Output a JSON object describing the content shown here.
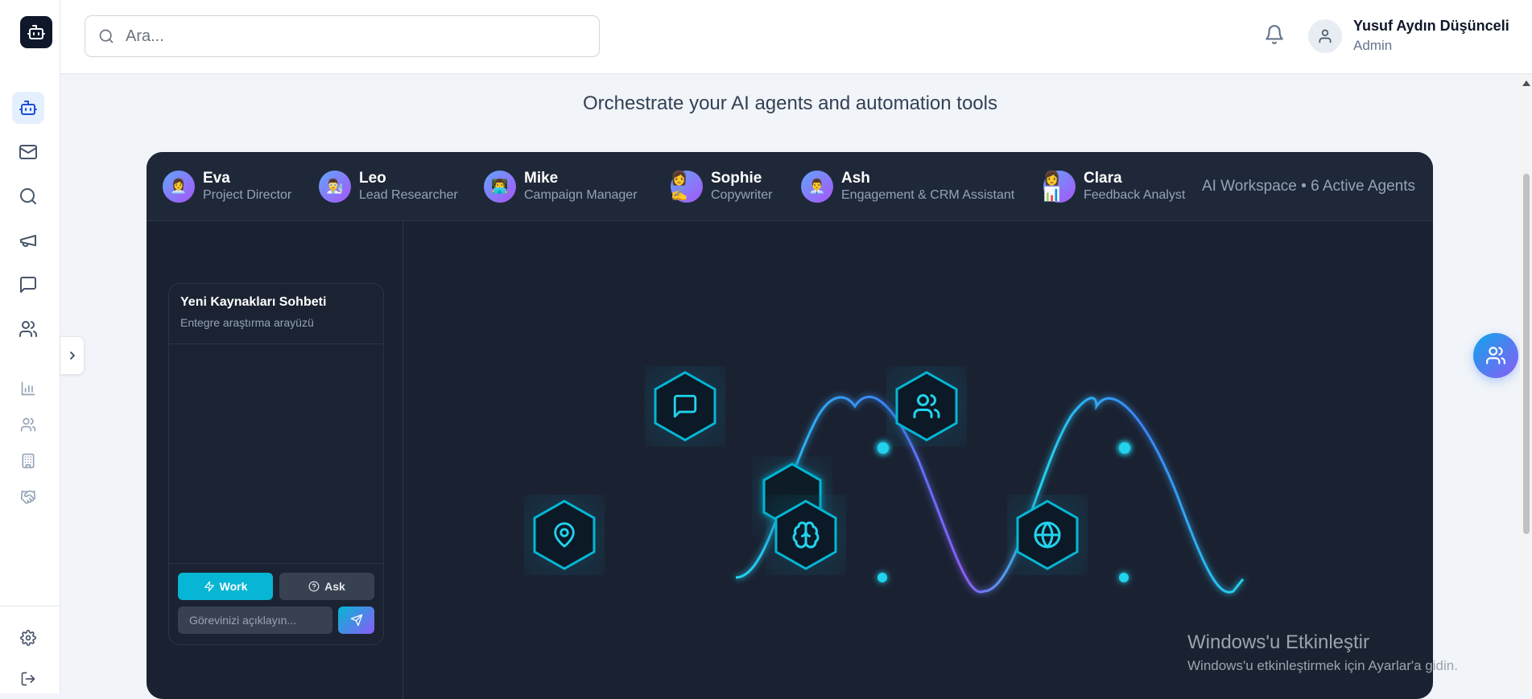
{
  "search": {
    "placeholder": "Ara..."
  },
  "user": {
    "name": "Yusuf Aydın Düşünceli",
    "role": "Admin"
  },
  "hero": {
    "subtitle": "Orchestrate your AI agents and automation tools"
  },
  "agents": [
    {
      "name": "Eva",
      "role": "Project Director",
      "emoji": "👩‍💼"
    },
    {
      "name": "Leo",
      "role": "Lead Researcher",
      "emoji": "👨‍🔬"
    },
    {
      "name": "Mike",
      "role": "Campaign Manager",
      "emoji": "👨‍💻"
    },
    {
      "name": "Sophie",
      "role": "Copywriter",
      "emoji": "👩✍️"
    },
    {
      "name": "Ash",
      "role": "Engagement & CRM Assistant",
      "emoji": "👨‍💼"
    },
    {
      "name": "Clara",
      "role": "Feedback Analyst",
      "emoji": "👩📊"
    }
  ],
  "workspace_status": "AI Workspace • 6 Active Agents",
  "chat": {
    "title": "Yeni Kaynakları Sohbeti",
    "description": "Entegre araştırma arayüzü",
    "work_label": "Work",
    "ask_label": "Ask",
    "input_placeholder": "Görevinizi açıklayın..."
  },
  "tool_icons": [
    "chat-icon",
    "users-icon",
    "map-pin-icon",
    "brain-icon",
    "globe-icon"
  ],
  "colors": {
    "accent": "#06b6d4",
    "accent2": "#8b5cf6",
    "workspace_bg": "#1a2232"
  },
  "watermark": {
    "title": "Windows'u Etkinleştir",
    "text": "Windows'u etkinleştirmek için Ayarlar'a gidin."
  }
}
